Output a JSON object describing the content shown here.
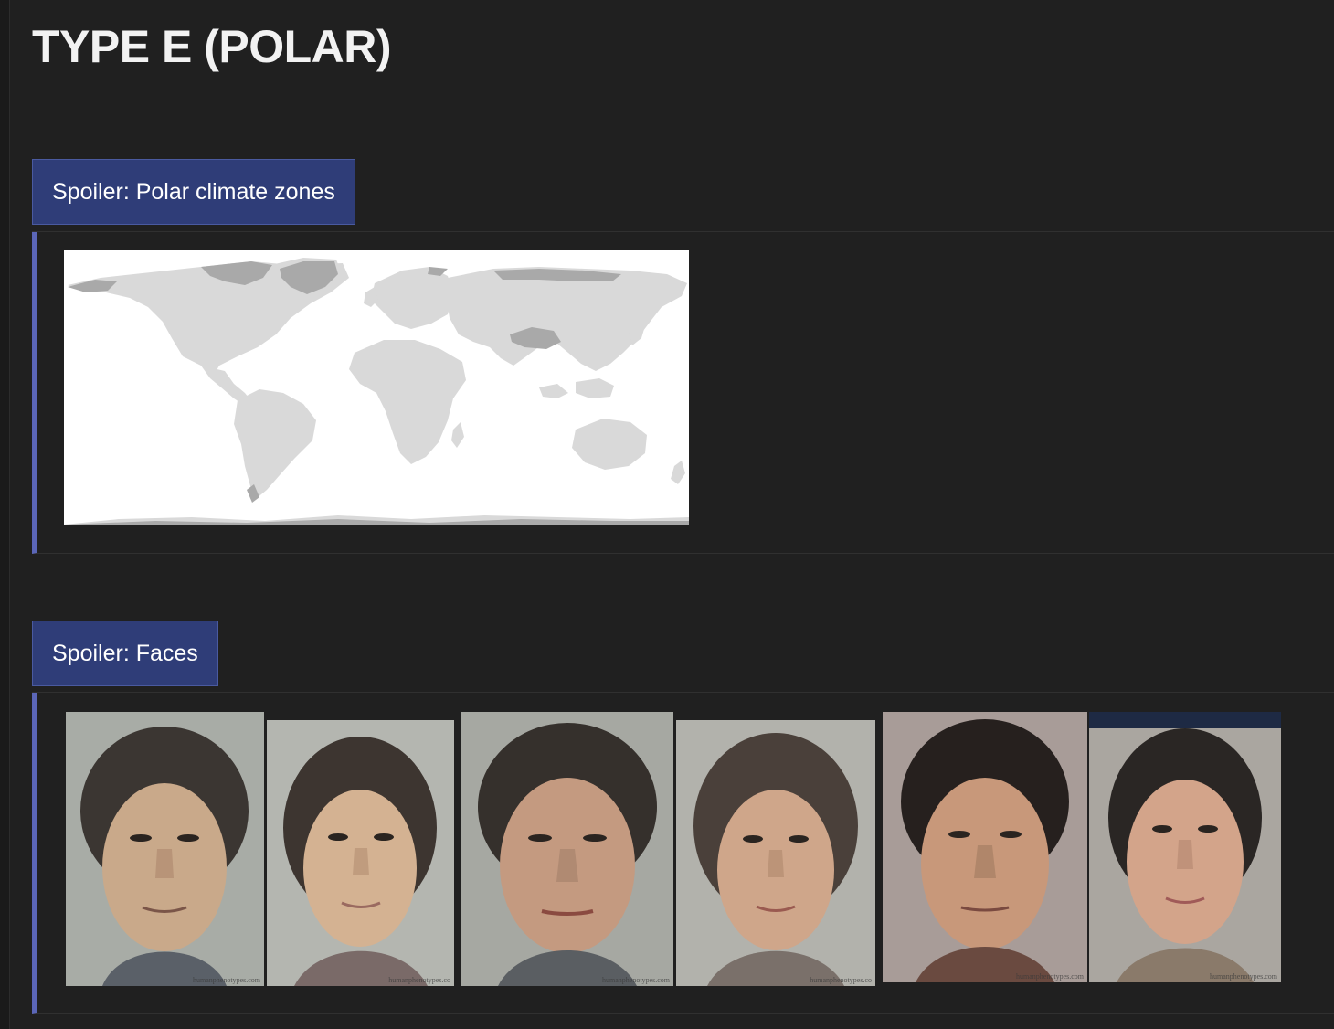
{
  "page": {
    "title": "TYPE E (POLAR)"
  },
  "spoilers": [
    {
      "label": "Spoiler: Polar climate zones",
      "content": {
        "map": {
          "icon": "world-map-icon",
          "land_color": "#d9d9d9",
          "polar_color": "#a9a9a9",
          "background": "#ffffff"
        }
      }
    },
    {
      "label": "Spoiler: Faces",
      "content": {
        "faces": [
          {
            "watermark": "humanphenotypes.com"
          },
          {
            "watermark": "humanphenotypes.co"
          },
          {
            "watermark": "humanphenotypes.com"
          },
          {
            "watermark": "humanphenotypes.co"
          },
          {
            "watermark": "humanphenotypes.com"
          },
          {
            "watermark": "humanphenotypes.com"
          }
        ]
      }
    }
  ],
  "colors": {
    "background": "#202020",
    "spoiler_button": "#2f3d78",
    "spoiler_accent": "#5b66b8"
  }
}
